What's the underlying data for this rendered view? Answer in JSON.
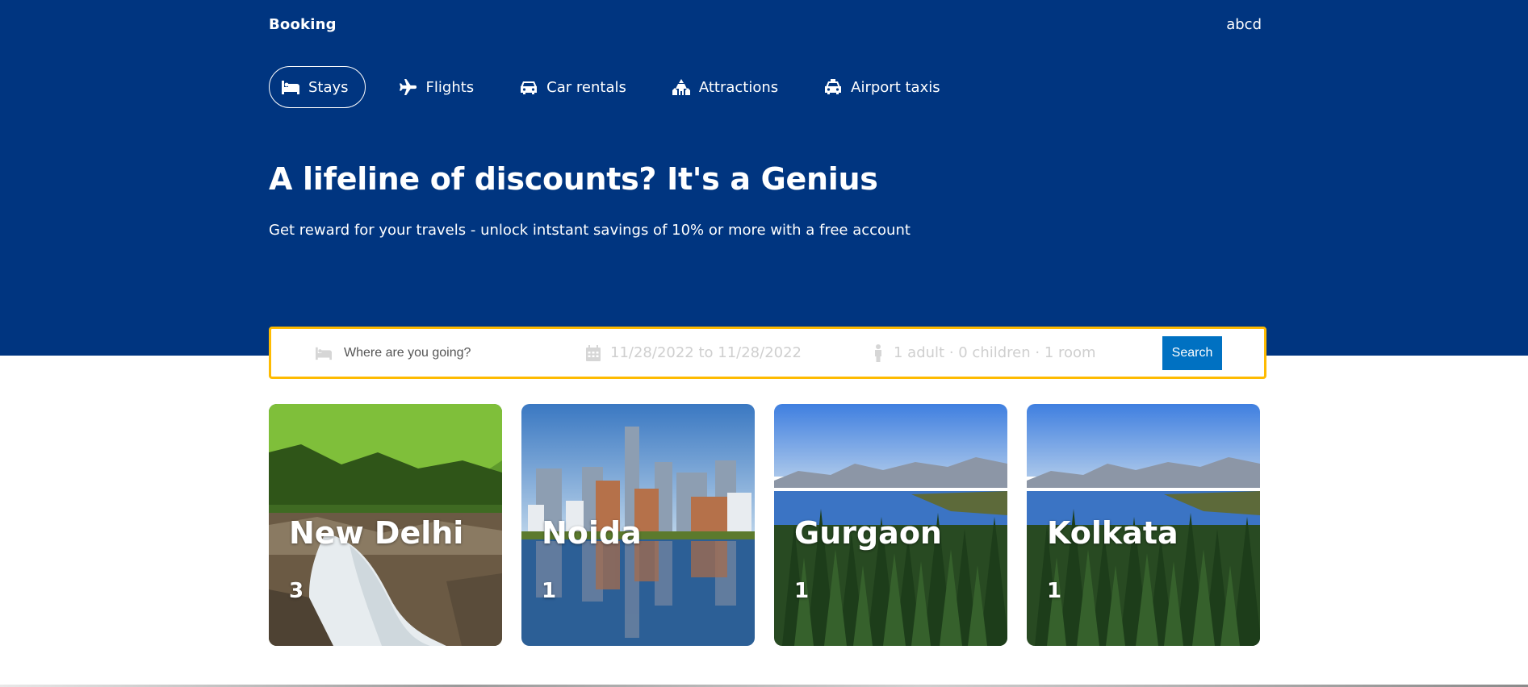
{
  "header": {
    "logo": "Booking",
    "user": "abcd",
    "nav": [
      {
        "label": "Stays",
        "icon": "bed-icon",
        "active": true
      },
      {
        "label": "Flights",
        "icon": "plane-icon",
        "active": false
      },
      {
        "label": "Car rentals",
        "icon": "car-icon",
        "active": false
      },
      {
        "label": "Attractions",
        "icon": "attractions-icon",
        "active": false
      },
      {
        "label": "Airport taxis",
        "icon": "taxi-icon",
        "active": false
      }
    ],
    "title": "A lifeline of discounts? It's a Genius",
    "subtitle": "Get reward for your travels - unlock intstant savings of 10% or more with a free account"
  },
  "search": {
    "destination_placeholder": "Where are you going?",
    "destination_value": "",
    "dates": "11/28/2022 to 11/28/2022",
    "options": "1 adult · 0 children · 1 room",
    "button": "Search"
  },
  "cards": [
    {
      "city": "New Delhi",
      "count": "3",
      "image": "waterfall-forest"
    },
    {
      "city": "Noida",
      "count": "1",
      "image": "city-skyline-reflection"
    },
    {
      "city": "Gurgaon",
      "count": "1",
      "image": "lake-pine-forest"
    },
    {
      "city": "Kolkata",
      "count": "1",
      "image": "lake-pine-forest"
    }
  ],
  "colors": {
    "header_bg": "#003580",
    "search_border": "#febb02",
    "button_bg": "#0071c2"
  }
}
